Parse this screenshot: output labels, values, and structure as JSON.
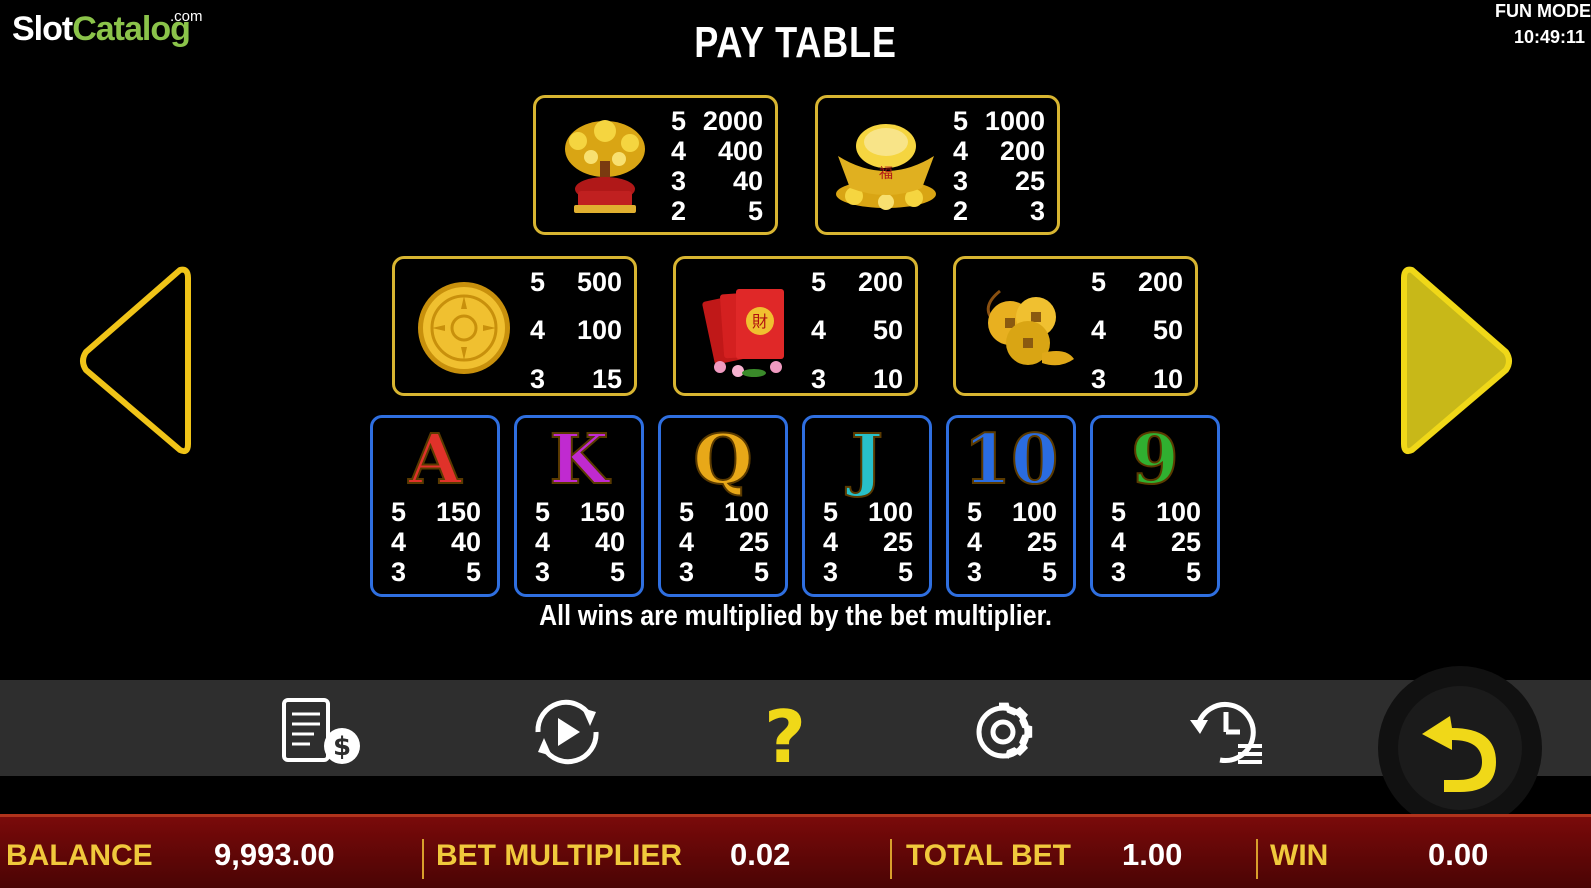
{
  "logo": {
    "slot": "Slot",
    "catalog": "Catalog",
    "com": ".com"
  },
  "mode": {
    "label": "FUN MODE",
    "time": "10:49:11"
  },
  "title": "PAY TABLE",
  "paytable": {
    "premium_top": [
      {
        "symbol": "money-tree",
        "pays": [
          [
            "5",
            "2000"
          ],
          [
            "4",
            "400"
          ],
          [
            "3",
            "40"
          ],
          [
            "2",
            "5"
          ]
        ]
      },
      {
        "symbol": "gold-ingot",
        "pays": [
          [
            "5",
            "1000"
          ],
          [
            "4",
            "200"
          ],
          [
            "3",
            "25"
          ],
          [
            "2",
            "3"
          ]
        ]
      }
    ],
    "premium_mid": [
      {
        "symbol": "gold-coin",
        "pays": [
          [
            "5",
            "500"
          ],
          [
            "4",
            "100"
          ],
          [
            "3",
            "15"
          ]
        ]
      },
      {
        "symbol": "red-envelopes",
        "pays": [
          [
            "5",
            "200"
          ],
          [
            "4",
            "50"
          ],
          [
            "3",
            "10"
          ]
        ]
      },
      {
        "symbol": "coin-string",
        "pays": [
          [
            "5",
            "200"
          ],
          [
            "4",
            "50"
          ],
          [
            "3",
            "10"
          ]
        ]
      }
    ],
    "low": [
      {
        "letter": "A",
        "color": "#e0322a",
        "pays": [
          [
            "5",
            "150"
          ],
          [
            "4",
            "40"
          ],
          [
            "3",
            "5"
          ]
        ]
      },
      {
        "letter": "K",
        "color": "#c02ad0",
        "pays": [
          [
            "5",
            "150"
          ],
          [
            "4",
            "40"
          ],
          [
            "3",
            "5"
          ]
        ]
      },
      {
        "letter": "Q",
        "color": "#e8a818",
        "pays": [
          [
            "5",
            "100"
          ],
          [
            "4",
            "25"
          ],
          [
            "3",
            "5"
          ]
        ]
      },
      {
        "letter": "J",
        "color": "#28c0c8",
        "pays": [
          [
            "5",
            "100"
          ],
          [
            "4",
            "25"
          ],
          [
            "3",
            "5"
          ]
        ]
      },
      {
        "letter": "10",
        "color": "#2a6ce0",
        "pays": [
          [
            "5",
            "100"
          ],
          [
            "4",
            "25"
          ],
          [
            "3",
            "5"
          ]
        ]
      },
      {
        "letter": "9",
        "color": "#30b030",
        "pays": [
          [
            "5",
            "100"
          ],
          [
            "4",
            "25"
          ],
          [
            "3",
            "5"
          ]
        ]
      }
    ]
  },
  "note": "All wins are multiplied by the bet multiplier.",
  "nav": {
    "prev_icon": "triangle-left-icon",
    "next_icon": "triangle-right-icon"
  },
  "toolbar": {
    "icons": [
      "paytable-dollar-icon",
      "autoplay-icon",
      "help-icon",
      "settings-gear-icon",
      "history-icon"
    ],
    "back_icon": "return-arrow-icon"
  },
  "status": {
    "balance_label": "BALANCE",
    "balance_value": "9,993.00",
    "bet_multiplier_label": "BET MULTIPLIER",
    "bet_multiplier_value": "0.02",
    "total_bet_label": "TOTAL BET",
    "total_bet_value": "1.00",
    "win_label": "WIN",
    "win_value": "0.00"
  },
  "colors": {
    "gold_border": "#d8b531",
    "blue_border": "#2f6fe0",
    "label_gold": "#f0c93c",
    "status_red": "#6a0808"
  }
}
